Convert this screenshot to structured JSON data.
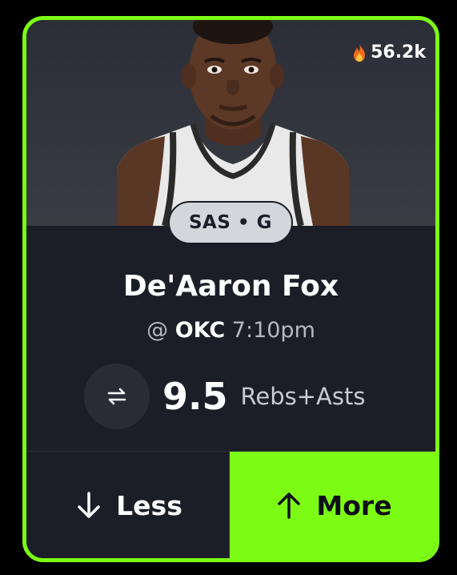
{
  "card": {
    "accent_color": "#7CFC14",
    "popularity": {
      "icon": "fire-icon",
      "count": "56.2k"
    },
    "player": {
      "team_position": "SAS • G",
      "name": "De'Aaron Fox",
      "matchup_prefix": "@",
      "opponent": "OKC",
      "game_time": "7:10pm"
    },
    "projection": {
      "swap_icon": "swap-arrows-icon",
      "line": "9.5",
      "stat": "Rebs+Asts"
    },
    "actions": {
      "less": {
        "label": "Less",
        "icon": "arrow-down-icon"
      },
      "more": {
        "label": "More",
        "icon": "arrow-up-icon",
        "selected": true
      }
    }
  }
}
